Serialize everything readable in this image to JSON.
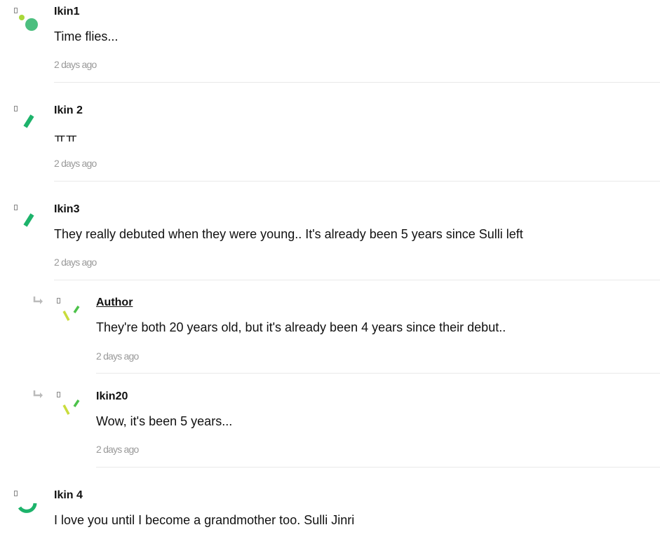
{
  "comments": [
    {
      "author": "Ikin1",
      "text": "Time flies...",
      "time": "2 days ago",
      "avatar": "dots"
    },
    {
      "author": "Ikin 2",
      "text": "ㅠㅠ",
      "time": "2 days ago",
      "avatar": "slash"
    },
    {
      "author": "Ikin3",
      "text": "They really debuted when they were young.. It's already been 5 years since Sulli left",
      "time": "2 days ago",
      "avatar": "slash"
    },
    {
      "author": "Author",
      "text": "They're both 20 years old, but it's already been 4 years since their debut..",
      "time": "2 days ago",
      "avatar": "ticks",
      "reply": true
    },
    {
      "author": "Ikin20",
      "text": "Wow, it's been 5 years...",
      "time": "2 days ago",
      "avatar": "ticks",
      "reply": true
    },
    {
      "author": "Ikin 4",
      "text": "I love you until I become a grandmother too. Sulli Jinri",
      "time": "",
      "avatar": "arc"
    }
  ],
  "colors": {
    "green": "#1db36b",
    "lime": "#a8d83a",
    "yellow_green": "#c9dc3c",
    "muted": "#9a9a9a",
    "divider": "#e9e9e9"
  }
}
